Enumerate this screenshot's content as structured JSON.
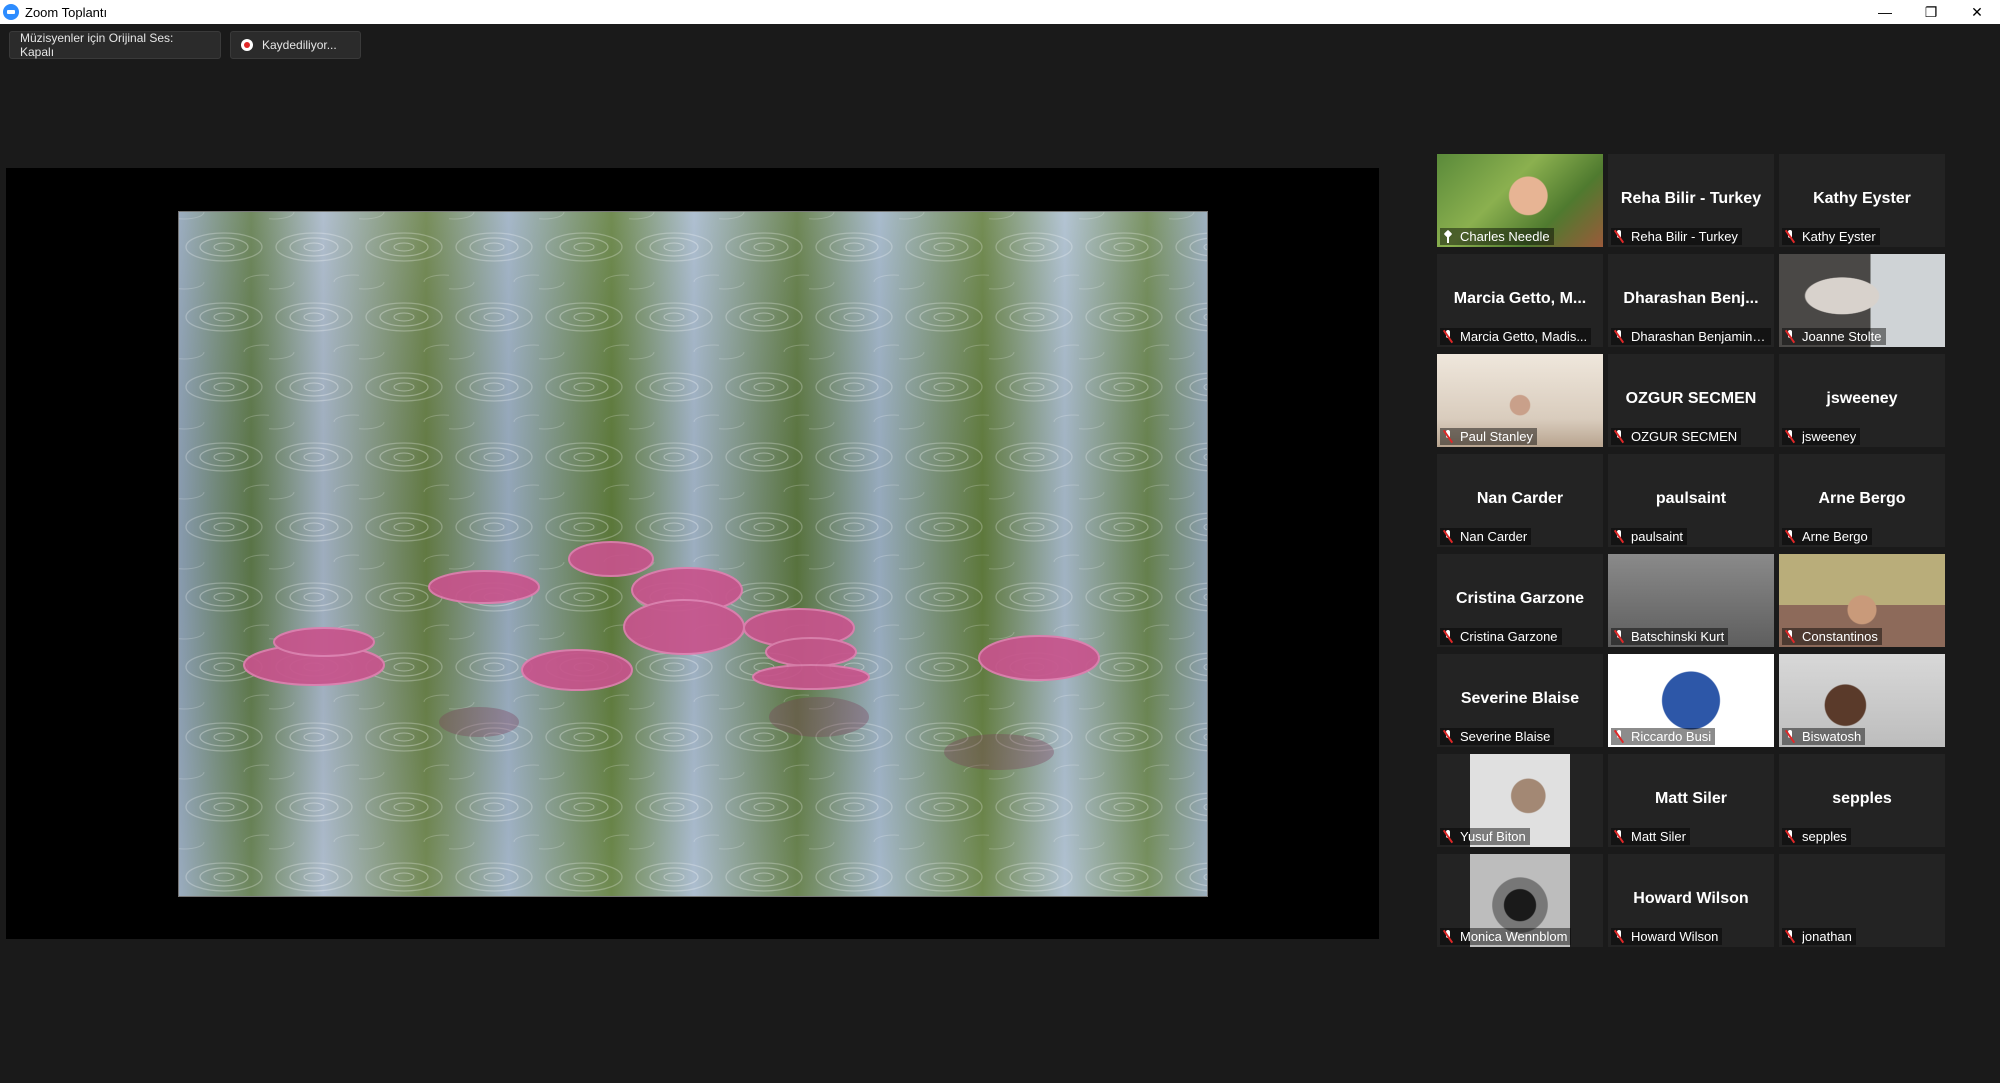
{
  "window": {
    "title": "Zoom Toplantı",
    "minimize": "—",
    "restore": "❐",
    "close": "✕"
  },
  "toolbar": {
    "original_sound_label": "Müzisyenler için Orijinal Ses: Kapalı",
    "recording_label": "Kaydediliyor..."
  },
  "participants": [
    {
      "name": "Charles Needle",
      "display": "",
      "video": true,
      "active": true,
      "icon": "pin-icon"
    },
    {
      "name": "Reha Bilir - Turkey",
      "display": "Reha Bilir - Turkey",
      "video": false,
      "icon": "muted-mic-icon"
    },
    {
      "name": "Kathy Eyster",
      "display": "Kathy Eyster",
      "video": false,
      "icon": "muted-mic-icon"
    },
    {
      "name": "Marcia Getto, Madis...",
      "display": "Marcia Getto, M...",
      "video": false,
      "icon": "muted-mic-icon"
    },
    {
      "name": "Dharashan Benjamine...",
      "display": "Dharashan Benj...",
      "video": false,
      "icon": "muted-mic-icon"
    },
    {
      "name": "Joanne Stolte",
      "display": "",
      "video": true,
      "icon": "muted-mic-icon"
    },
    {
      "name": "Paul Stanley",
      "display": "",
      "video": true,
      "icon": "muted-mic-icon"
    },
    {
      "name": "OZGUR SECMEN",
      "display": "OZGUR SECMEN",
      "video": false,
      "icon": "muted-mic-icon"
    },
    {
      "name": "jsweeney",
      "display": "jsweeney",
      "video": false,
      "icon": "muted-mic-icon"
    },
    {
      "name": "Nan Carder",
      "display": "Nan Carder",
      "video": false,
      "icon": "muted-mic-icon"
    },
    {
      "name": "paulsaint",
      "display": "paulsaint",
      "video": false,
      "icon": "muted-mic-icon"
    },
    {
      "name": "Arne Bergo",
      "display": "Arne Bergo",
      "video": false,
      "icon": "muted-mic-icon"
    },
    {
      "name": "Cristina Garzone",
      "display": "Cristina Garzone",
      "video": false,
      "icon": "muted-mic-icon"
    },
    {
      "name": "Batschinski Kurt",
      "display": "",
      "video": true,
      "icon": "muted-mic-icon"
    },
    {
      "name": "Constantinos",
      "display": "",
      "video": true,
      "icon": "muted-mic-icon"
    },
    {
      "name": "Severine Blaise",
      "display": "Severine Blaise",
      "video": false,
      "icon": "muted-mic-icon"
    },
    {
      "name": "Riccardo Busi",
      "display": "",
      "video": true,
      "icon": "muted-mic-icon"
    },
    {
      "name": "Biswatosh",
      "display": "",
      "video": true,
      "icon": "muted-mic-icon"
    },
    {
      "name": "Yusuf Biton",
      "display": "",
      "video": true,
      "icon": "muted-mic-icon"
    },
    {
      "name": "Matt Siler",
      "display": "Matt Siler",
      "video": false,
      "icon": "muted-mic-icon"
    },
    {
      "name": "sepples",
      "display": "sepples",
      "video": false,
      "icon": "muted-mic-icon"
    },
    {
      "name": "Monica Wennblom",
      "display": "",
      "video": true,
      "icon": "muted-mic-icon"
    },
    {
      "name": "Howard Wilson",
      "display": "Howard Wilson",
      "video": false,
      "icon": "muted-mic-icon"
    },
    {
      "name": "jonathan",
      "display": "",
      "video": false,
      "icon": "muted-mic-icon"
    }
  ],
  "colors": {
    "background": "#1a1a1a",
    "tile": "#232323",
    "active_speaker_border": "#c9d73a",
    "mute_red": "#e02828"
  }
}
